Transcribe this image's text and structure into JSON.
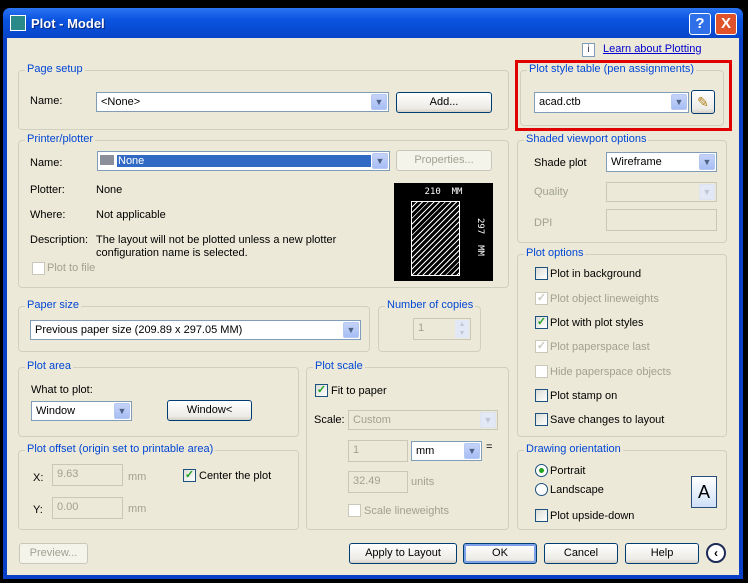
{
  "window": {
    "title": "Plot - Model",
    "help": "?",
    "close": "X"
  },
  "learn_link": "Learn about Plotting",
  "page_setup": {
    "title": "Page setup",
    "name_label": "Name:",
    "name_value": "<None>",
    "add": "Add..."
  },
  "plot_style": {
    "title": "Plot style table (pen assignments)",
    "value": "acad.ctb"
  },
  "printer": {
    "title": "Printer/plotter",
    "name_label": "Name:",
    "name_value": "None",
    "properties": "Properties...",
    "plotter_label": "Plotter:",
    "plotter_value": "None",
    "where_label": "Where:",
    "where_value": "Not applicable",
    "desc_label": "Description:",
    "desc_line1": "The layout will not be plotted unless a new plotter",
    "desc_line2": "configuration name is selected.",
    "plot_to_file": "Plot to file",
    "preview_width": "210  MM",
    "preview_height": "297  MM"
  },
  "paper_size": {
    "title": "Paper size",
    "value": "Previous paper size (209.89 x 297.05 MM)"
  },
  "copies": {
    "title": "Number of copies",
    "value": "1"
  },
  "plot_area": {
    "title": "Plot area",
    "what_label": "What to plot:",
    "what_value": "Window",
    "window_button": "Window<"
  },
  "plot_offset": {
    "title": "Plot offset (origin set to printable area)",
    "x_label": "X:",
    "x_value": "9.63",
    "y_label": "Y:",
    "y_value": "0.00",
    "unit": "mm",
    "center": "Center the plot",
    "center_checked": true
  },
  "plot_scale": {
    "title": "Plot scale",
    "fit": "Fit to paper",
    "fit_checked": true,
    "scale_label": "Scale:",
    "scale_value": "Custom",
    "num": "1",
    "unit_value": "mm",
    "equals": "=",
    "units_value": "32.49",
    "units_label": "units",
    "scale_lw": "Scale lineweights"
  },
  "shaded": {
    "title": "Shaded viewport options",
    "shade_label": "Shade plot",
    "shade_value": "Wireframe",
    "quality_label": "Quality",
    "dpi_label": "DPI"
  },
  "plot_options": {
    "title": "Plot options",
    "items": [
      {
        "label": "Plot in background",
        "checked": false,
        "enabled": true
      },
      {
        "label": "Plot object lineweights",
        "checked": true,
        "enabled": false
      },
      {
        "label": "Plot with plot styles",
        "checked": true,
        "enabled": true
      },
      {
        "label": "Plot paperspace last",
        "checked": true,
        "enabled": false
      },
      {
        "label": "Hide paperspace objects",
        "checked": false,
        "enabled": false
      },
      {
        "label": "Plot stamp on",
        "checked": false,
        "enabled": true
      },
      {
        "label": "Save changes to layout",
        "checked": false,
        "enabled": true
      }
    ]
  },
  "orientation": {
    "title": "Drawing orientation",
    "portrait": "Portrait",
    "landscape": "Landscape",
    "selected": "Portrait",
    "upside_down": "Plot upside-down",
    "icon_letter": "A"
  },
  "buttons": {
    "preview": "Preview...",
    "apply": "Apply to Layout",
    "ok": "OK",
    "cancel": "Cancel",
    "help": "Help"
  },
  "colors": {
    "highlight_box": "#e00000",
    "group_label": "#0046d5",
    "link": "#0000cc"
  }
}
